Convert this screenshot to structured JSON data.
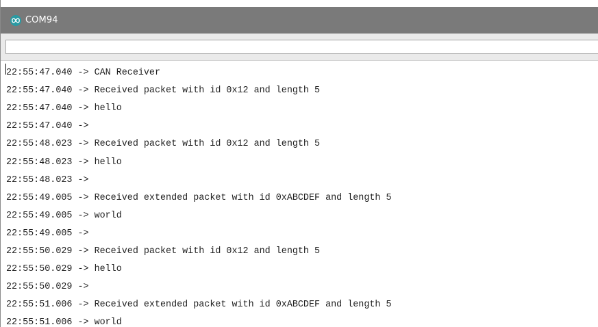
{
  "window": {
    "title": "COM94",
    "icon": "arduino-infinity-icon"
  },
  "send_input": {
    "value": "",
    "placeholder": ""
  },
  "serial_output": {
    "lines": [
      "22:55:47.040 -> CAN Receiver",
      "22:55:47.040 -> Received packet with id 0x12 and length 5",
      "22:55:47.040 -> hello",
      "22:55:47.040 -> ",
      "22:55:48.023 -> Received packet with id 0x12 and length 5",
      "22:55:48.023 -> hello",
      "22:55:48.023 -> ",
      "22:55:49.005 -> Received extended packet with id 0xABCDEF and length 5",
      "22:55:49.005 -> world",
      "22:55:49.005 -> ",
      "22:55:50.029 -> Received packet with id 0x12 and length 5",
      "22:55:50.029 -> hello",
      "22:55:50.029 -> ",
      "22:55:51.006 -> Received extended packet with id 0xABCDEF and length 5",
      "22:55:51.006 -> world"
    ]
  },
  "colors": {
    "titlebar": "#7a7a7a",
    "toolbar": "#eaeaea",
    "icon_teal": "#2a9aa3",
    "text": "#1e1e1e"
  }
}
